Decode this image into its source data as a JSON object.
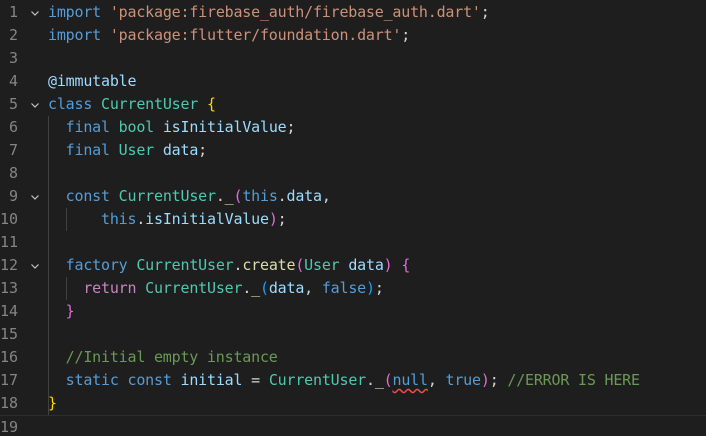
{
  "editor": {
    "theme_colors": {
      "background": "#1e1e1e",
      "keyword": "#569cd6",
      "string": "#ce9178",
      "type": "#4ec9b0",
      "function": "#dcdcaa",
      "variable": "#9cdcfe",
      "comment": "#6a9955",
      "error_squiggle": "#f14c4c"
    },
    "lines": [
      {
        "num": "1",
        "fold": "chevron-down-icon",
        "tokens": [
          [
            "kw",
            "import"
          ],
          [
            "pn",
            " "
          ],
          [
            "str",
            "'package:firebase_auth/firebase_auth.dart'"
          ],
          [
            "pn",
            ";"
          ]
        ]
      },
      {
        "num": "2",
        "fold": "",
        "tokens": [
          [
            "kw",
            "import"
          ],
          [
            "pn",
            " "
          ],
          [
            "str",
            "'package:flutter/foundation.dart'"
          ],
          [
            "pn",
            ";"
          ]
        ]
      },
      {
        "num": "3",
        "fold": "",
        "tokens": []
      },
      {
        "num": "4",
        "fold": "",
        "tokens": [
          [
            "var",
            "@immutable"
          ]
        ]
      },
      {
        "num": "5",
        "fold": "chevron-down-icon",
        "tokens": [
          [
            "kw",
            "class"
          ],
          [
            "pn",
            " "
          ],
          [
            "type",
            "CurrentUser"
          ],
          [
            "pn",
            " "
          ],
          [
            "br1",
            "{"
          ]
        ]
      },
      {
        "num": "6",
        "fold": "",
        "tokens": [
          [
            "pn",
            "  "
          ],
          [
            "kw",
            "final"
          ],
          [
            "pn",
            " "
          ],
          [
            "type",
            "bool"
          ],
          [
            "pn",
            " "
          ],
          [
            "var",
            "isInitialValue"
          ],
          [
            "pn",
            ";"
          ]
        ]
      },
      {
        "num": "7",
        "fold": "",
        "tokens": [
          [
            "pn",
            "  "
          ],
          [
            "kw",
            "final"
          ],
          [
            "pn",
            " "
          ],
          [
            "type",
            "User"
          ],
          [
            "pn",
            " "
          ],
          [
            "var",
            "data"
          ],
          [
            "pn",
            ";"
          ]
        ]
      },
      {
        "num": "8",
        "fold": "",
        "tokens": []
      },
      {
        "num": "9",
        "fold": "chevron-down-icon",
        "tokens": [
          [
            "pn",
            "  "
          ],
          [
            "kw",
            "const"
          ],
          [
            "pn",
            " "
          ],
          [
            "type",
            "CurrentUser"
          ],
          [
            "pn",
            "."
          ],
          [
            "fn",
            "_"
          ],
          [
            "br2",
            "("
          ],
          [
            "kw",
            "this"
          ],
          [
            "pn",
            "."
          ],
          [
            "var",
            "data"
          ],
          [
            "pn",
            ","
          ]
        ]
      },
      {
        "num": "10",
        "fold": "",
        "tokens": [
          [
            "pn",
            "      "
          ],
          [
            "kw",
            "this"
          ],
          [
            "pn",
            "."
          ],
          [
            "var",
            "isInitialValue"
          ],
          [
            "br2",
            ")"
          ],
          [
            "pn",
            ";"
          ]
        ]
      },
      {
        "num": "11",
        "fold": "",
        "tokens": []
      },
      {
        "num": "12",
        "fold": "chevron-down-icon",
        "tokens": [
          [
            "pn",
            "  "
          ],
          [
            "kw",
            "factory"
          ],
          [
            "pn",
            " "
          ],
          [
            "type",
            "CurrentUser"
          ],
          [
            "pn",
            "."
          ],
          [
            "fn",
            "create"
          ],
          [
            "br2",
            "("
          ],
          [
            "type",
            "User"
          ],
          [
            "pn",
            " "
          ],
          [
            "var",
            "data"
          ],
          [
            "br2",
            ")"
          ],
          [
            "pn",
            " "
          ],
          [
            "br2",
            "{"
          ]
        ]
      },
      {
        "num": "13",
        "fold": "",
        "tokens": [
          [
            "pn",
            "    "
          ],
          [
            "ctl",
            "return"
          ],
          [
            "pn",
            " "
          ],
          [
            "type",
            "CurrentUser"
          ],
          [
            "pn",
            "."
          ],
          [
            "fn",
            "_"
          ],
          [
            "br3",
            "("
          ],
          [
            "var",
            "data"
          ],
          [
            "pn",
            ", "
          ],
          [
            "kw",
            "false"
          ],
          [
            "br3",
            ")"
          ],
          [
            "pn",
            ";"
          ]
        ]
      },
      {
        "num": "14",
        "fold": "",
        "tokens": [
          [
            "pn",
            "  "
          ],
          [
            "br2",
            "}"
          ]
        ]
      },
      {
        "num": "15",
        "fold": "",
        "tokens": []
      },
      {
        "num": "16",
        "fold": "",
        "tokens": [
          [
            "pn",
            "  "
          ],
          [
            "cm",
            "//Initial empty instance"
          ]
        ]
      },
      {
        "num": "17",
        "fold": "",
        "tokens": [
          [
            "pn",
            "  "
          ],
          [
            "kw",
            "static"
          ],
          [
            "pn",
            " "
          ],
          [
            "kw",
            "const"
          ],
          [
            "pn",
            " "
          ],
          [
            "var",
            "initial"
          ],
          [
            "pn",
            " = "
          ],
          [
            "type",
            "CurrentUser"
          ],
          [
            "pn",
            "."
          ],
          [
            "fn",
            "_"
          ],
          [
            "br2",
            "("
          ],
          [
            "kw err",
            "null"
          ],
          [
            "pn",
            ", "
          ],
          [
            "kw",
            "true"
          ],
          [
            "br2",
            ")"
          ],
          [
            "pn",
            "; "
          ],
          [
            "cm",
            "//ERROR IS HERE"
          ]
        ]
      },
      {
        "num": "18",
        "fold": "",
        "tokens": [
          [
            "br1",
            "}"
          ]
        ]
      },
      {
        "num": "19",
        "fold": "",
        "tokens": []
      }
    ]
  }
}
